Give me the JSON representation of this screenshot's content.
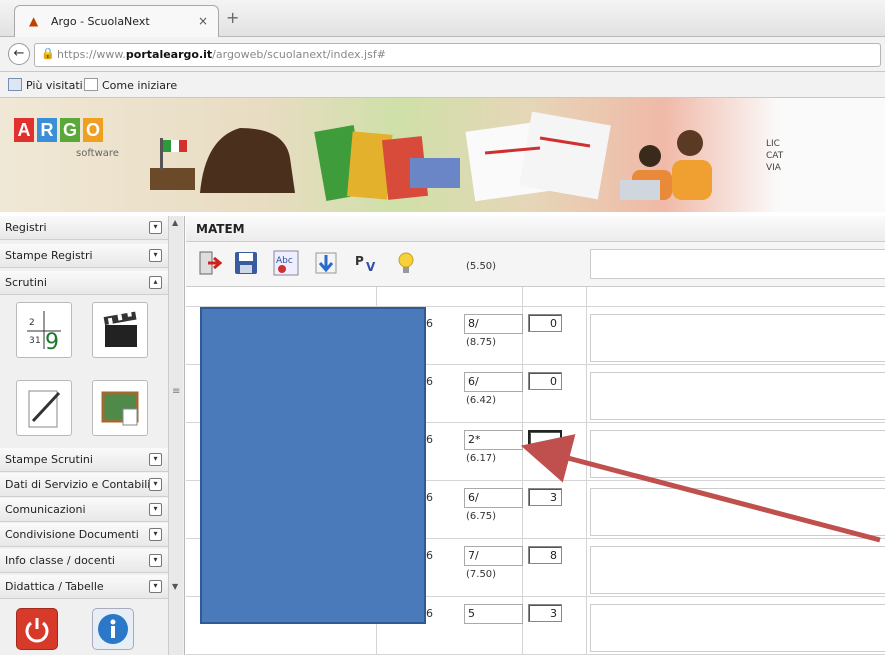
{
  "browser": {
    "tab_title": "Argo - ScuolaNext",
    "tab_close": "×",
    "new_tab": "+",
    "url_prefix": "https://www.",
    "url_domain": "portaleargo.it",
    "url_path": "/argoweb/scuolanext/index.jsf#",
    "bookmarks": [
      "Più visitati",
      "Come iniziare"
    ]
  },
  "banner": {
    "logo_letters": [
      "A",
      "R",
      "G",
      "O"
    ],
    "logo_colors": [
      "#e0312f",
      "#3b8fd6",
      "#5aa83a",
      "#f0a020"
    ],
    "logo_sub": "software",
    "right_text": [
      "LIC",
      "CAT",
      "VIA"
    ]
  },
  "sidebar": {
    "top_items": [
      {
        "label": "Registri",
        "toggle": "▾"
      },
      {
        "label": "Stampe Registri",
        "toggle": "▾"
      },
      {
        "label": "Scrutini",
        "toggle": "▴"
      }
    ],
    "bottom_items": [
      {
        "label": "Stampe Scrutini",
        "toggle": "▾"
      },
      {
        "label": "Dati di Servizio e Contabili",
        "toggle": "▾"
      },
      {
        "label": "Comunicazioni",
        "toggle": "▾"
      },
      {
        "label": "Condivisione Documenti",
        "toggle": "▾"
      },
      {
        "label": "Info classe / docenti",
        "toggle": "▾"
      },
      {
        "label": "Didattica / Tabelle",
        "toggle": "▾"
      }
    ],
    "tile_digit": "9",
    "tile_small": [
      "2",
      "3",
      "1"
    ]
  },
  "main": {
    "title": "MATEM",
    "partial_avg_top": "(5.50)",
    "rows": [
      {
        "id_suffix": "6",
        "vote": "8/",
        "avg": "(8.75)",
        "absences": "0"
      },
      {
        "id_suffix": "6",
        "vote": "6/",
        "avg": "(6.42)",
        "absences": "0"
      },
      {
        "id_suffix": "6",
        "vote": "2*",
        "avg": "(6.17)",
        "absences": ""
      },
      {
        "id_suffix": "6",
        "vote": "6/",
        "avg": "(6.75)",
        "absences": "3"
      },
      {
        "id_suffix": "6",
        "vote": "7/",
        "avg": "(7.50)",
        "absences": "8"
      },
      {
        "id_suffix": "6",
        "vote": "5",
        "avg": "",
        "absences": "3"
      }
    ]
  },
  "annotation": {
    "arrow_color": "#c0504d",
    "redaction_color": "#4a7ab9"
  }
}
